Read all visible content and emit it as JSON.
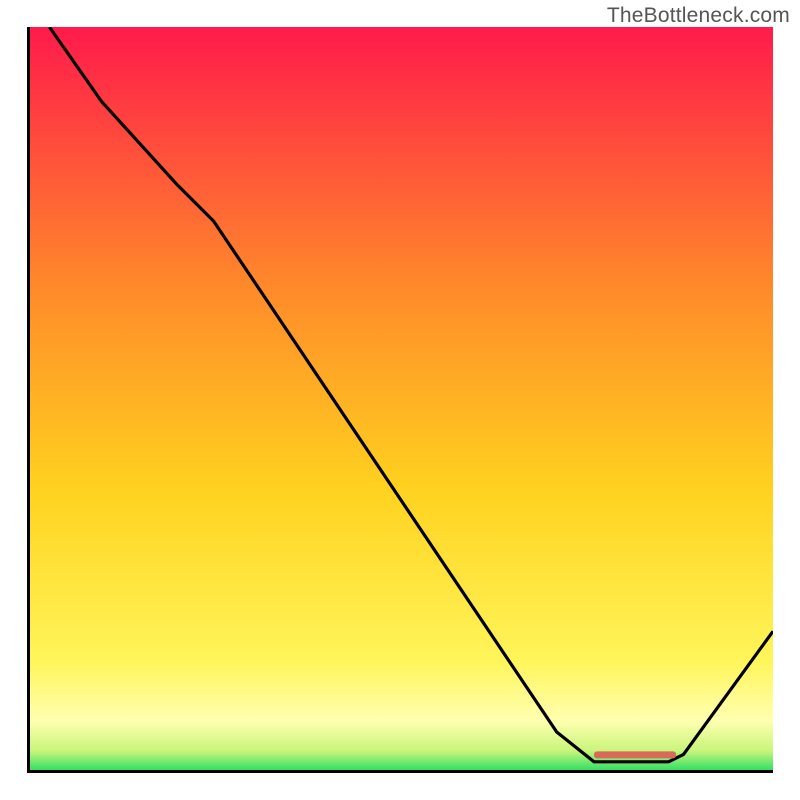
{
  "watermark": "TheBottleneck.com",
  "colors": {
    "gradient_top": "#ff1a4b",
    "gradient_mid1": "#ff6a2a",
    "gradient_mid2": "#ffd21f",
    "gradient_pale": "#ffffaa",
    "gradient_bottom": "#1fdc64",
    "axis": "#000000",
    "line": "#000000",
    "marker": "#d96a5a"
  },
  "chart_data": {
    "type": "line",
    "title": "",
    "xlabel": "",
    "ylabel": "",
    "xlim": [
      0,
      100
    ],
    "ylim": [
      0,
      100
    ],
    "x": [
      3,
      10,
      20,
      25,
      71,
      76,
      86,
      88,
      100
    ],
    "values": [
      100,
      90,
      79,
      74,
      5.5,
      1.5,
      1.5,
      2.5,
      19
    ],
    "flat_segment": {
      "x_start": 76,
      "x_end": 86,
      "y": 1.5
    },
    "marker_bar": {
      "x_start": 76,
      "x_end": 87,
      "y": 2.5
    },
    "grid": false,
    "legend": false
  }
}
